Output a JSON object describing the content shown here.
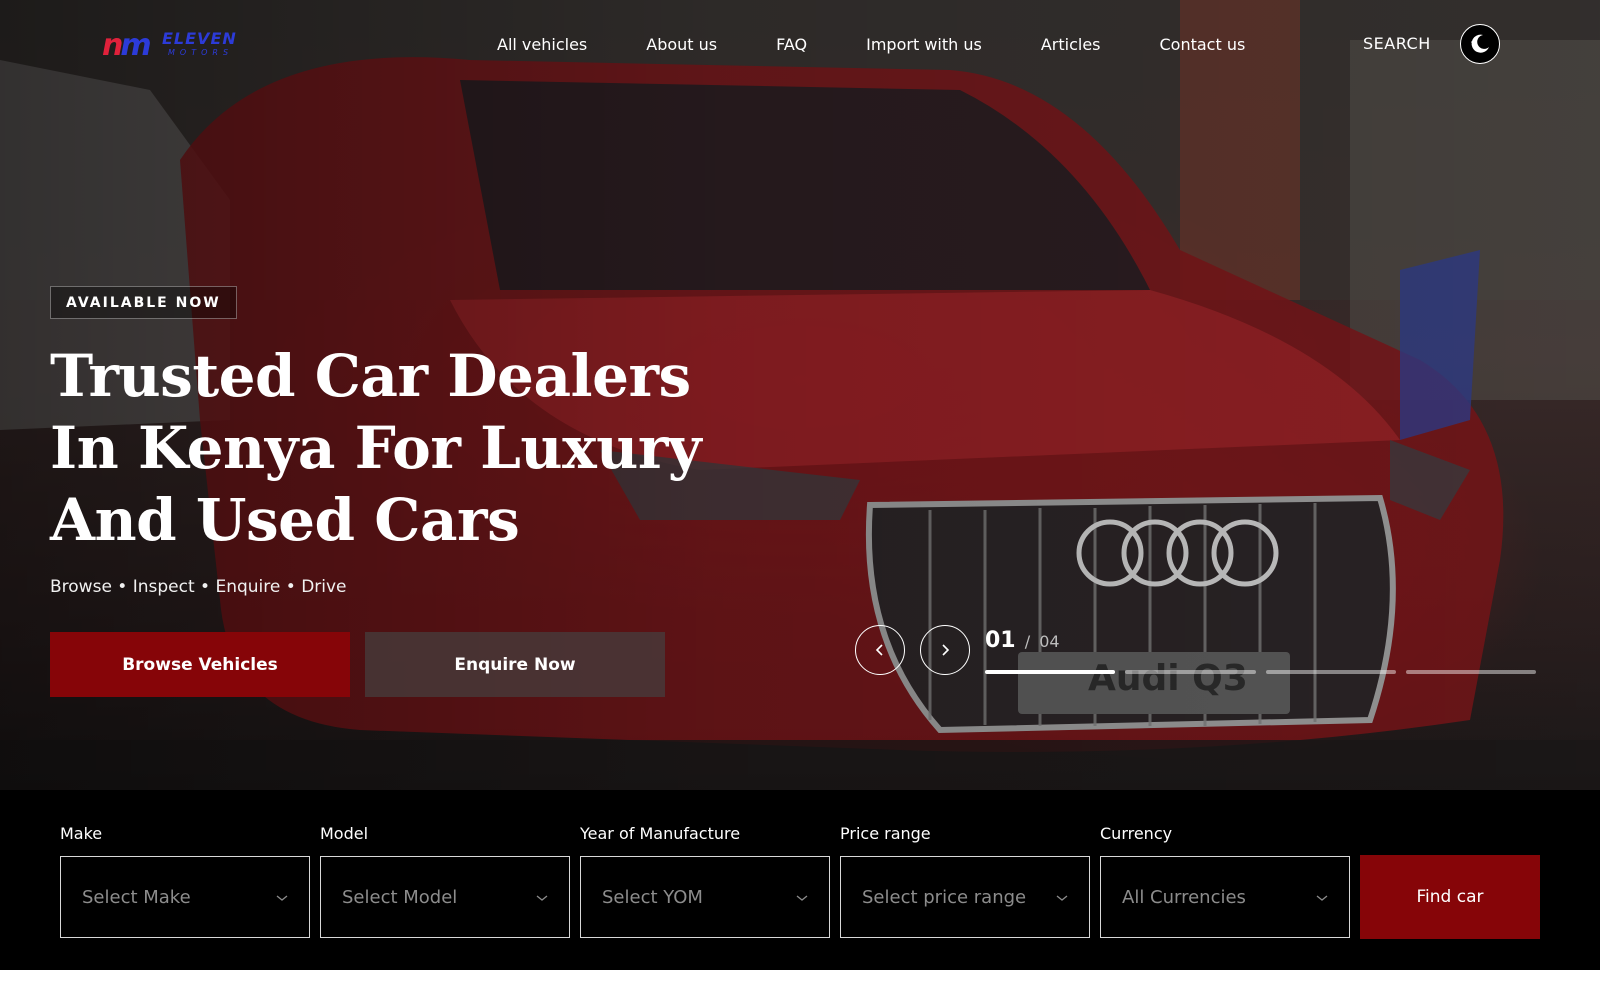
{
  "brand": {
    "mark": "nm",
    "name": "ELEVEN",
    "tagline": "MOTORS"
  },
  "nav": {
    "links": [
      "All vehicles",
      "About us",
      "FAQ",
      "Import with us",
      "Articles",
      "Contact us"
    ],
    "search_label": "SEARCH",
    "theme_toggle_icon": "moon-icon"
  },
  "hero": {
    "badge": "AVAILABLE NOW",
    "title": "Trusted Car Dealers In Kenya For Luxury And Used Cars",
    "subtitle": "Browse • Inspect • Enquire • Drive",
    "primary_button": "Browse Vehicles",
    "secondary_button": "Enquire Now",
    "image_caption": "Audi Q3"
  },
  "slider": {
    "current": "01",
    "separator": "/",
    "total": "04",
    "active_index": 0,
    "prev_icon": "chevron-left-icon",
    "next_icon": "chevron-right-icon"
  },
  "search": {
    "fields": [
      {
        "label": "Make",
        "placeholder": "Select Make"
      },
      {
        "label": "Model",
        "placeholder": "Select Model"
      },
      {
        "label": "Year of Manufacture",
        "placeholder": "Select YOM"
      },
      {
        "label": "Price range",
        "placeholder": "Select price range"
      },
      {
        "label": "Currency",
        "placeholder": "All Currencies"
      }
    ],
    "submit": "Find car"
  },
  "colors": {
    "accent": "#860508",
    "panel_background": "#000000",
    "logo_red": "#e0213b",
    "logo_blue": "#2c3bd8"
  }
}
